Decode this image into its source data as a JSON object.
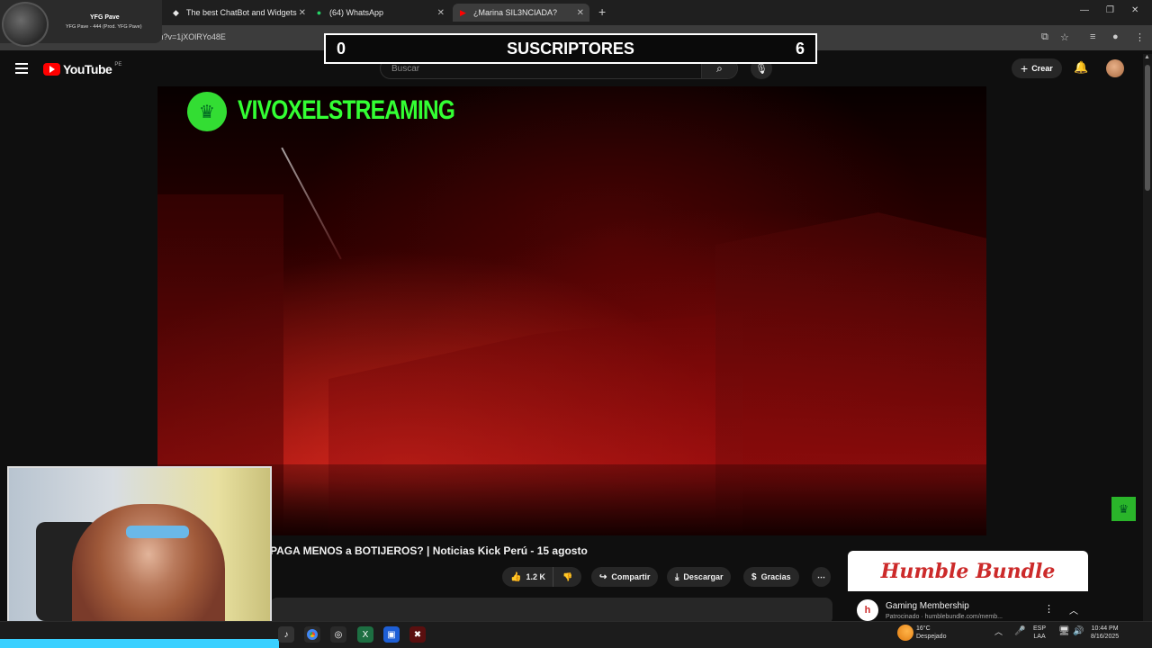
{
  "browser": {
    "tabs": [
      {
        "title": "",
        "icon": "profile-icon"
      },
      {
        "title": "The best ChatBot and Widgets",
        "icon": "chatbot-icon"
      },
      {
        "title": "(64) WhatsApp",
        "icon": "whatsapp-icon"
      },
      {
        "title": "¿Marina SIL3NCIADA?",
        "icon": "youtube-icon"
      }
    ],
    "url": "youtube.com/watch?v=1jXOlRYo48E"
  },
  "profile_overlay": {
    "name": "YFG Pave",
    "subtitle": "YFG Pave - 444 (Prod. YFG Pave)"
  },
  "subscriber_overlay": {
    "left_count": "0",
    "label": "SUSCRIPTORES",
    "right_count": "6"
  },
  "youtube": {
    "logo_text": "YouTube",
    "country": "PE",
    "search_placeholder": "Buscar",
    "create_label": "Crear"
  },
  "video": {
    "channel_overlay": "VIVOXELSTREAMING",
    "title": "PAGA MENOS a BOTIJEROS? | Noticias Kick Perú - 15 agosto",
    "actions": {
      "likes": "1.2 K",
      "share": "Compartir",
      "download": "Descargar",
      "thanks": "Gracias"
    }
  },
  "ad": {
    "banner": "Humble Bundle",
    "title": "Gaming Membership",
    "sponsored": "Patrocinado · humblebundle.com/memb..."
  },
  "taskbar": {
    "weather_temp": "16°C",
    "weather_desc": "Despejado",
    "lang": "ESP",
    "lang_sub": "LAA",
    "time": "10:44 PM",
    "date": "8/16/2025"
  },
  "colors": {
    "accent_green": "#33ff33",
    "youtube_red": "#ff0000",
    "humble_red": "#cc2a2a"
  }
}
